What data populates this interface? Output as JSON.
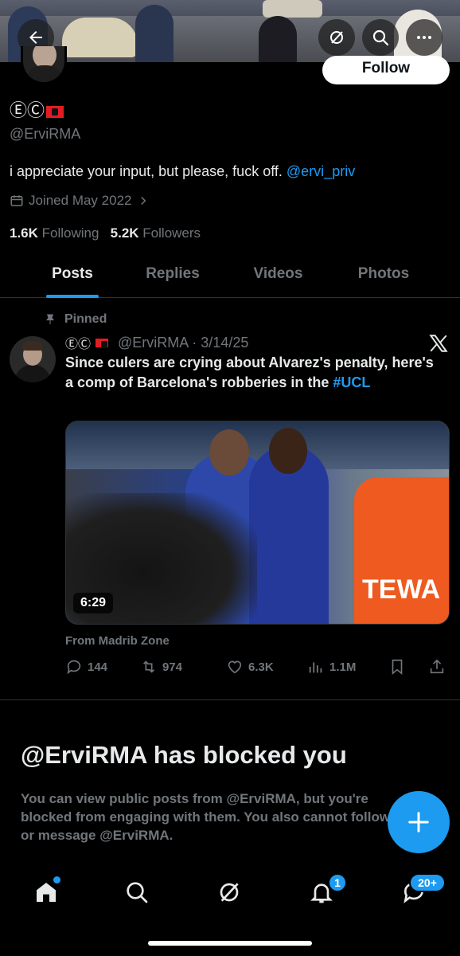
{
  "header": {
    "follow_label": "Follow"
  },
  "profile": {
    "display_name": "ⒺⒸ",
    "flag_icon": "albania-flag-icon",
    "handle": "@ErviRMA",
    "bio": "i appreciate your input, but please, fuck off.",
    "bio_mention": "@ervi_priv",
    "joined": "Joined May 2022",
    "following_count": "1.6K",
    "following_label": "Following",
    "followers_count": "5.2K",
    "followers_label": "Followers"
  },
  "tabs": [
    {
      "label": "Posts",
      "active": true
    },
    {
      "label": "Replies",
      "active": false
    },
    {
      "label": "Videos",
      "active": false
    },
    {
      "label": "Photos",
      "active": false
    }
  ],
  "post": {
    "pinned_label": "Pinned",
    "author_name": "ⒺⒸ",
    "author_handle": "@ErviRMA",
    "date": "· 3/14/25",
    "text": "Since culers are crying about Alvarez's penalty, here's a comp of Barcelona's robberies in the",
    "hashtag": "#UCL",
    "video_duration": "6:29",
    "from_label": "From Madrib Zone",
    "video_overlay_text": "TEWA",
    "replies": "144",
    "reposts": "974",
    "likes": "6.3K",
    "views": "1.1M"
  },
  "blocked": {
    "title": "@ErviRMA has blocked you",
    "message": "You can view public posts from @ErviRMA, but you're blocked from engaging with them. You also cannot follow or message @ErviRMA."
  },
  "bottom_nav": {
    "notifications_badge": "1",
    "messages_badge": "20+"
  },
  "colors": {
    "accent": "#1d9bf0",
    "background": "#000000",
    "muted": "#71767b",
    "text": "#e7e9ea"
  }
}
